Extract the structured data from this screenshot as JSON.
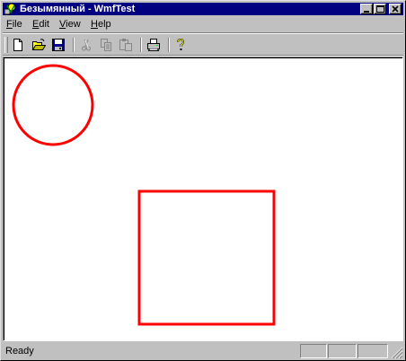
{
  "window": {
    "title": "Безымянный - WmfTest",
    "app_icon": "wmftest-app-icon"
  },
  "caption_buttons": [
    "minimize-icon",
    "maximize-icon",
    "close-icon"
  ],
  "menu": {
    "items": [
      {
        "label": "File",
        "mnemonic": "F",
        "rest": "ile"
      },
      {
        "label": "Edit",
        "mnemonic": "E",
        "rest": "dit"
      },
      {
        "label": "View",
        "mnemonic": "V",
        "rest": "iew"
      },
      {
        "label": "Help",
        "mnemonic": "H",
        "rest": "elp"
      }
    ]
  },
  "toolbar": {
    "buttons": [
      {
        "icon": "new-document-icon",
        "enabled": true
      },
      {
        "icon": "open-folder-icon",
        "enabled": true
      },
      {
        "icon": "save-disk-icon",
        "enabled": true
      },
      {
        "icon": "cut-scissors-icon",
        "enabled": false
      },
      {
        "icon": "copy-icon",
        "enabled": false
      },
      {
        "icon": "paste-clipboard-icon",
        "enabled": false
      },
      {
        "icon": "print-icon",
        "enabled": true
      },
      {
        "icon": "help-question-icon",
        "enabled": true
      }
    ]
  },
  "canvas": {
    "shapes": [
      {
        "type": "circle",
        "stroke": "#ff0000"
      },
      {
        "type": "rectangle",
        "stroke": "#ff0000"
      }
    ]
  },
  "statusbar": {
    "text": "Ready",
    "panes": [
      "",
      "",
      ""
    ]
  },
  "colors": {
    "titlebar": "#000080",
    "face": "#c0c0c0",
    "shape_stroke": "#ff0000"
  }
}
